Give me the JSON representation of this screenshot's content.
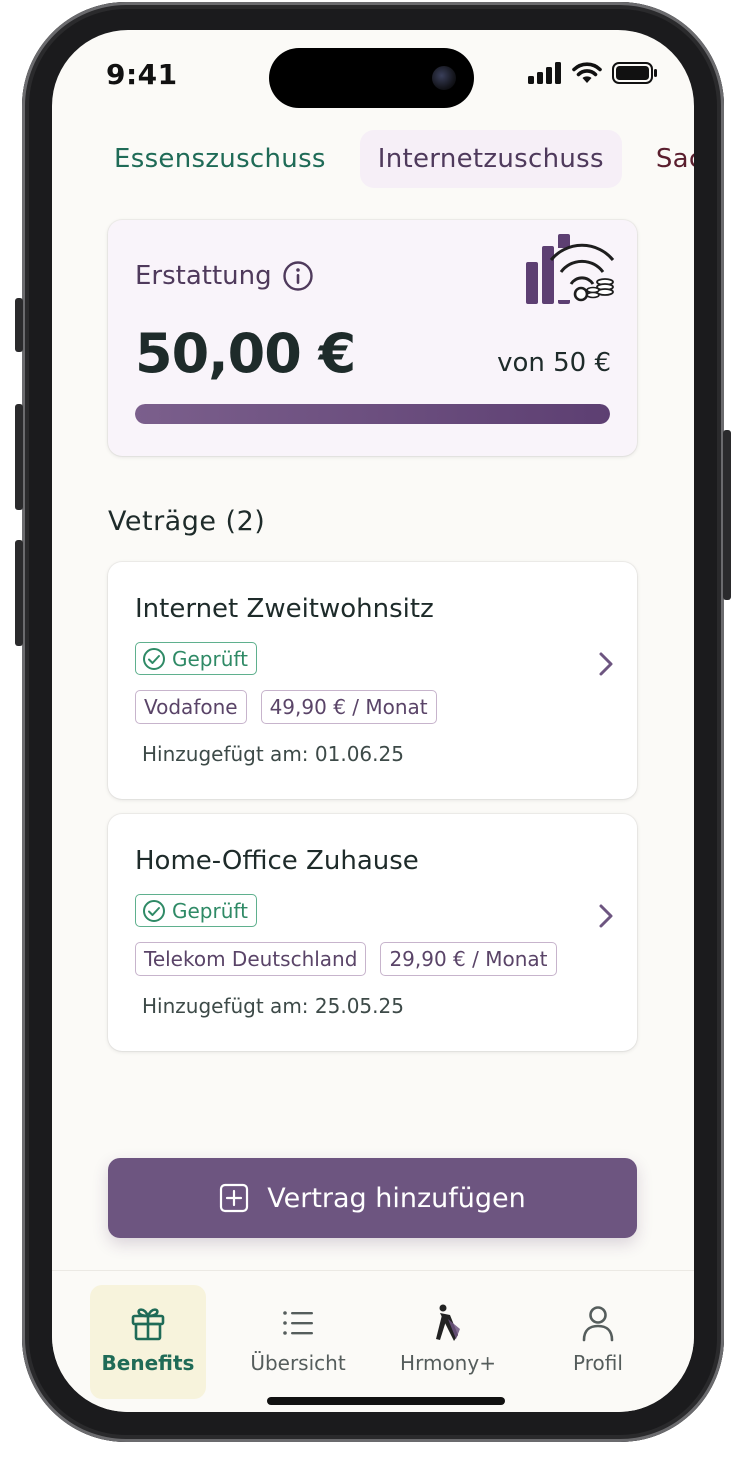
{
  "status": {
    "time": "9:41"
  },
  "tabs": [
    {
      "label": "Essenszuschuss",
      "active": false
    },
    {
      "label": "Internetzuschuss",
      "active": true
    },
    {
      "label": "Sac",
      "active": false
    }
  ],
  "refund": {
    "label": "Erstattung",
    "amount": "50,00 €",
    "limit": "von 50 €",
    "progress_fraction": 1.0
  },
  "contracts": {
    "section_title": "Veträge (2)",
    "items": [
      {
        "title": "Internet Zweitwohnsitz",
        "status": "Geprüft",
        "provider": "Vodafone",
        "price": "49,90 € / Monat",
        "added": "Hinzugefügt am: 01.06.25"
      },
      {
        "title": "Home-Office Zuhause",
        "status": "Geprüft",
        "provider": "Telekom Deutschland",
        "price": "29,90 € / Monat",
        "added": "Hinzugefügt am: 25.05.25"
      }
    ]
  },
  "cta": {
    "label": "Vertrag hinzufügen",
    "icon": "plus-square-icon"
  },
  "nav": [
    {
      "label": "Benefits",
      "icon": "gift-icon",
      "active": true
    },
    {
      "label": "Übersicht",
      "icon": "list-icon",
      "active": false
    },
    {
      "label": "Hrmony+",
      "icon": "hrmony-logo-icon",
      "active": false
    },
    {
      "label": "Profil",
      "icon": "user-icon",
      "active": false
    }
  ],
  "colors": {
    "brand_purple": "#6d5580",
    "brand_green": "#1f6b57",
    "verified_green": "#2f8a66",
    "background": "#fbfaf7"
  }
}
